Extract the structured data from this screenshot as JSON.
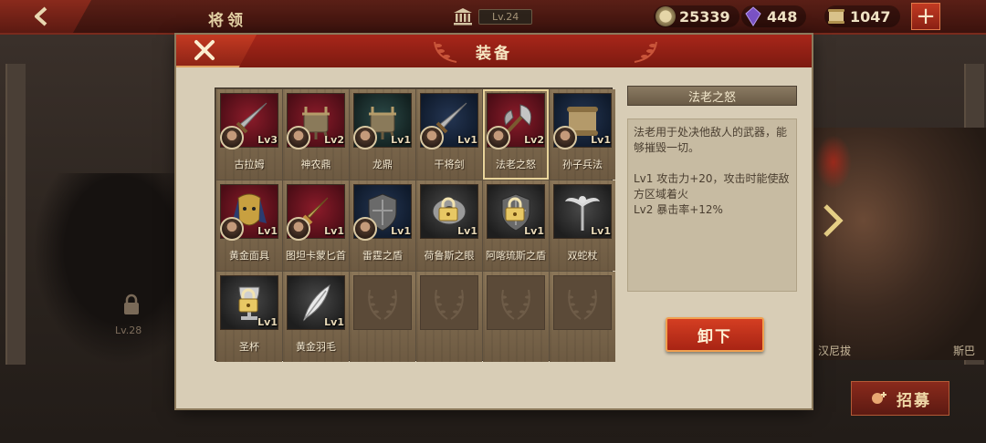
{
  "topbar": {
    "title": "将领",
    "level_label": "Lv.24",
    "resources": {
      "coins": "25339",
      "gems": "448",
      "scrolls": "1047"
    },
    "plus_label": "+"
  },
  "background": {
    "locked_hero_level": "Lv.28",
    "hero_name_left": "汉尼拔",
    "hero_name_right": "斯巴",
    "recruit_label": "招募"
  },
  "modal": {
    "title": "装备",
    "grid": [
      {
        "name": "古拉姆",
        "level": "Lv3",
        "locked": false,
        "empty": false,
        "art": "red",
        "icon": "sword-icon",
        "avatar": true,
        "selected": false
      },
      {
        "name": "神农鼎",
        "level": "Lv2",
        "locked": false,
        "empty": false,
        "art": "red",
        "icon": "cauldron-icon",
        "avatar": true,
        "selected": false
      },
      {
        "name": "龙鼎",
        "level": "Lv1",
        "locked": false,
        "empty": false,
        "art": "teal",
        "icon": "cauldron-icon",
        "avatar": true,
        "selected": false
      },
      {
        "name": "干将剑",
        "level": "Lv1",
        "locked": false,
        "empty": false,
        "art": "navy",
        "icon": "sword-icon",
        "avatar": true,
        "selected": false
      },
      {
        "name": "法老之怒",
        "level": "Lv2",
        "locked": false,
        "empty": false,
        "art": "red",
        "icon": "axe-icon",
        "avatar": true,
        "selected": true
      },
      {
        "name": "孙子兵法",
        "level": "Lv1",
        "locked": false,
        "empty": false,
        "art": "navy",
        "icon": "scroll-icon",
        "avatar": true,
        "selected": false
      },
      {
        "name": "黄金面具",
        "level": "Lv1",
        "locked": false,
        "empty": false,
        "art": "red",
        "icon": "mask-icon",
        "avatar": true,
        "selected": false
      },
      {
        "name": "图坦卡蒙匕首",
        "level": "Lv1",
        "locked": false,
        "empty": false,
        "art": "red",
        "icon": "dagger-icon",
        "avatar": true,
        "selected": false
      },
      {
        "name": "雷霆之盾",
        "level": "Lv1",
        "locked": false,
        "empty": false,
        "art": "navy",
        "icon": "shield-icon",
        "avatar": true,
        "selected": false
      },
      {
        "name": "荷鲁斯之眼",
        "level": "Lv1",
        "locked": true,
        "empty": false,
        "art": "gray",
        "icon": "eye-icon",
        "avatar": false,
        "selected": false
      },
      {
        "name": "阿喀琉斯之盾",
        "level": "Lv1",
        "locked": true,
        "empty": false,
        "art": "gray",
        "icon": "shield-icon",
        "avatar": false,
        "selected": false
      },
      {
        "name": "双蛇杖",
        "level": "Lv1",
        "locked": false,
        "empty": false,
        "art": "gray",
        "icon": "staff-icon",
        "avatar": false,
        "selected": false
      },
      {
        "name": "圣杯",
        "level": "Lv1",
        "locked": true,
        "empty": false,
        "art": "gray",
        "icon": "chalice-icon",
        "avatar": false,
        "selected": false
      },
      {
        "name": "黄金羽毛",
        "level": "Lv1",
        "locked": false,
        "empty": false,
        "art": "gray",
        "icon": "feather-icon",
        "avatar": false,
        "selected": false
      },
      {
        "name": "",
        "level": "",
        "locked": false,
        "empty": true
      },
      {
        "name": "",
        "level": "",
        "locked": false,
        "empty": true
      },
      {
        "name": "",
        "level": "",
        "locked": false,
        "empty": true
      },
      {
        "name": "",
        "level": "",
        "locked": false,
        "empty": true
      }
    ],
    "detail": {
      "title": "法老之怒",
      "description": "法老用于处决他敌人的武器，能够摧毁一切。",
      "effects": [
        "Lv1  攻击力+20，攻击时能使敌方区域着火",
        "Lv2  暴击率+12%"
      ]
    },
    "unequip_label": "卸下"
  },
  "colors": {
    "header_red": "#a8261a",
    "panel_bg": "#d8cdb6",
    "button_red": "#d43e22",
    "selected_outline": "#e8d39a"
  }
}
